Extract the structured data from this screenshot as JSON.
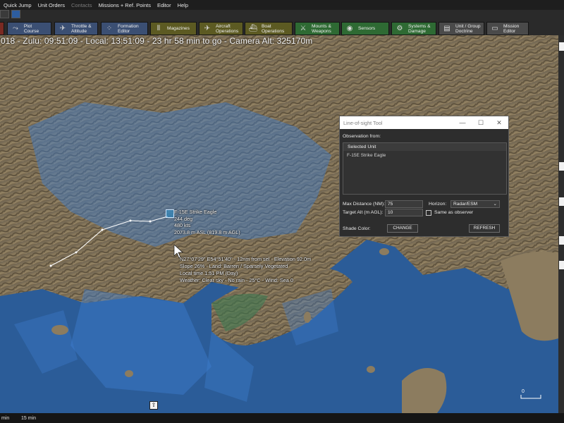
{
  "menu": [
    "Quick Jump",
    "Unit Orders",
    "Contacts",
    "Missions + Ref. Points",
    "Editor",
    "Help"
  ],
  "menu_disabled": [
    "Contacts"
  ],
  "toolbar": {
    "plot_course": "Plot Course",
    "throttle": "Throttle &\nAltitude",
    "formation": "Formation\nEditor",
    "magazines": "Magazines",
    "aircraft_ops": "Aircraft\nOperations",
    "boat_ops": "Boat\nOperations",
    "mounts": "Mounts &\nWeapons",
    "sensors": "Sensors",
    "systems": "Systems &\nDamage",
    "doctrine": "Unit / Group\nDoctrine",
    "mission_editor": "Mission\nEditor"
  },
  "toolbar_colors": {
    "green": "#2e6a33",
    "blue": "#3b4f73",
    "olive": "#5c5a22",
    "gray": "#4a4a4a",
    "dark": "#2f2f2f"
  },
  "clock": "018 - Zulu: 09:51:09 - Local: 13:51:09 - 23 hr 58 min to go -  Camera Alt: 325170m",
  "unit": {
    "name": "F-15E Strike Eagle",
    "heading": "244 deg",
    "speed": "480 kts",
    "altitude": "2073.8 m ASL (819.8 m AGL)"
  },
  "hover_info": {
    "line1": "N27°07'29\"  E54°51'40\" - 12nm from sel - Elevation 92.0m",
    "line2": "Slope 26% - Land: Barren / Sparsely Vegetated",
    "line3": "Local time 1:51 PM (Day)",
    "line4": "Weather: Clear sky - No rain - 25°C - Wind: Sea 0"
  },
  "dialog": {
    "title": "Line-of-sight Tool",
    "observation_label": "Observation from:",
    "list_header": "Selected Unit",
    "list_items": [
      "F-15E Strike Eagle"
    ],
    "max_distance_label": "Max Distance (NM):",
    "max_distance_value": "75",
    "target_alt_label": "Target Alt (m AGL):",
    "target_alt_value": "10",
    "horizon_label": "Horizon:",
    "horizon_value": "Radar/ESM",
    "same_as_observer": "Same as observer",
    "shade_color_label": "Shade Color:",
    "change_button": "CHANGE",
    "refresh_button": "REFRESH"
  },
  "bottom": {
    "left": "min",
    "right": "15 min"
  },
  "scale_label": "0",
  "colors": {
    "sea": "#2c5e99",
    "land": "#8c7a5e",
    "los_shade": "#3f7fd0",
    "menubar": "#1e1e1e"
  }
}
